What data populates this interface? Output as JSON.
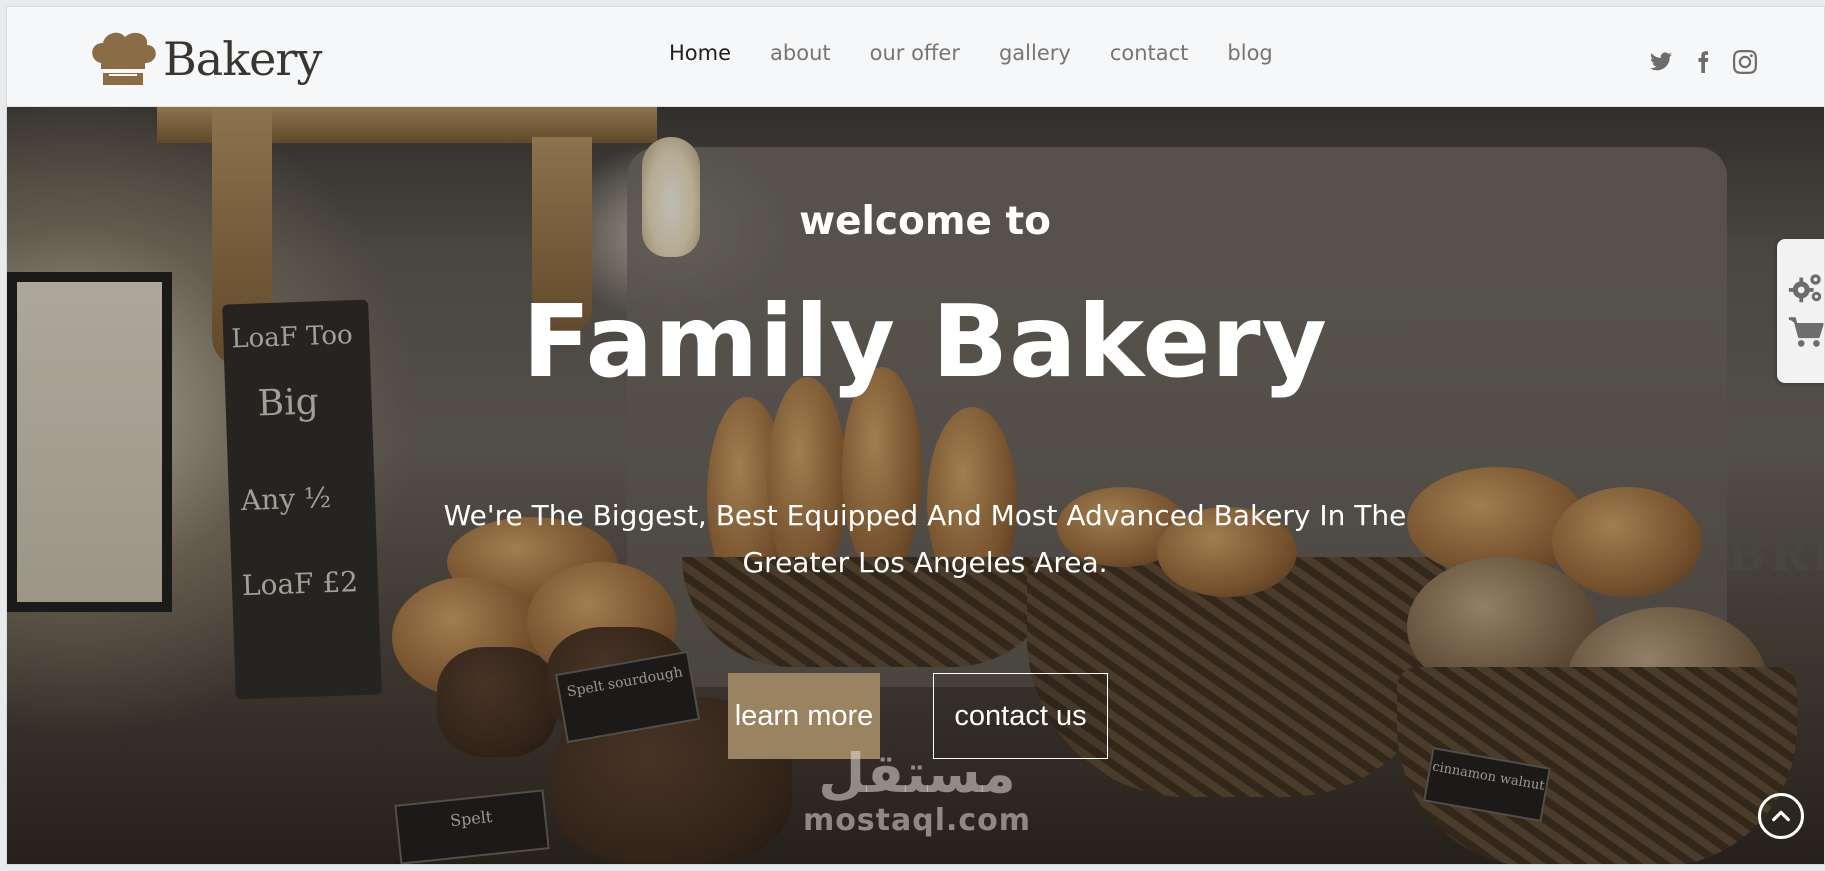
{
  "brand": {
    "name": "Bakery",
    "logo_icon": "chef-hat-icon",
    "color": "#8b6d45"
  },
  "nav": {
    "items": [
      {
        "label": "Home",
        "active": true
      },
      {
        "label": "about",
        "active": false
      },
      {
        "label": "our offer",
        "active": false
      },
      {
        "label": "gallery",
        "active": false
      },
      {
        "label": "contact",
        "active": false
      },
      {
        "label": "blog",
        "active": false
      }
    ]
  },
  "social": [
    "twitter-icon",
    "facebook-icon",
    "instagram-icon"
  ],
  "hero": {
    "welcome": "welcome to",
    "title": "Family Bakery",
    "subtitle": "We're The Biggest, Best Equipped And Most Advanced Bakery In The Greater Los Angeles Area.",
    "primary_button": "learn more",
    "secondary_button": "contact us",
    "accent_color": "#9a8360"
  },
  "scene_text": {
    "chalkboard": [
      "LoaF Too",
      "Big",
      "Any ½",
      "LoaF £2"
    ],
    "label_spelt_sourdough": "Spelt sourdough",
    "label_spelt": "Spelt",
    "label_walnut": "cinnamon walnut",
    "bread_bin": "BRE"
  },
  "watermark": {
    "arabic": "مستقل",
    "latin": "mostaql.com"
  },
  "side_panel": {
    "icons": [
      "settings-gears-icon",
      "shopping-cart-icon"
    ]
  },
  "scroll_top": {
    "icon": "chevron-up-icon"
  }
}
